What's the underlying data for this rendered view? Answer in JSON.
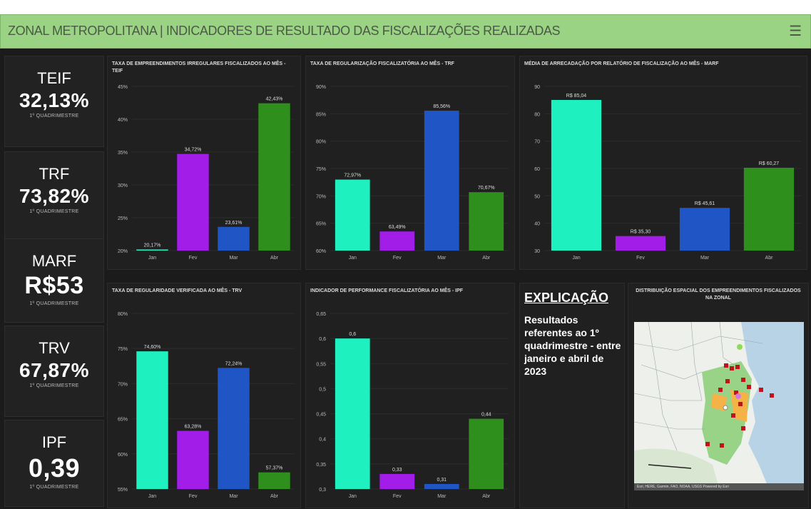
{
  "header": {
    "title": "ZONAL METROPOLITANA | INDICADORES DE RESULTADO DAS FISCALIZAÇÕES REALIZADAS",
    "menu_icon": "hamburger-menu-icon"
  },
  "kpis": [
    {
      "code": "TEIF",
      "value": "32,13%",
      "sub": "1º QUADRIMESTRE"
    },
    {
      "code": "TRF",
      "value": "73,82%",
      "sub": "1º QUADRIMESTRE"
    },
    {
      "code": "MARF",
      "value": "R$53",
      "sub": "1º QUADRIMESTRE"
    },
    {
      "code": "TRV",
      "value": "67,87%",
      "sub": "1º QUADRIMESTRE"
    },
    {
      "code": "IPF",
      "value": "0,39",
      "sub": "1º QUADRIMESTRE"
    }
  ],
  "colors": {
    "jan": "#1ff0c0",
    "fev": "#a21ee8",
    "mar": "#1f55c4",
    "abr": "#2f8f1c",
    "background": "#1b1b1b",
    "header": "#9ad383"
  },
  "chart_data": [
    {
      "type": "bar",
      "title": "TAXA DE EMPREENDIMENTOS IRREGULARES FISCALIZADOS AO MÊS - TEIF",
      "categories": [
        "Jan",
        "Fev",
        "Mar",
        "Abr"
      ],
      "values": [
        20.17,
        34.72,
        23.61,
        42.43
      ],
      "data_labels": [
        "20,17%",
        "34,72%",
        "23,61%",
        "42,43%"
      ],
      "yticks": [
        "20%",
        "25%",
        "30%",
        "35%",
        "40%",
        "45%"
      ],
      "ylim": [
        20,
        45
      ]
    },
    {
      "type": "bar",
      "title": "TAXA DE REGULARIZAÇÃO FISCALIZATÓRIA AO MÊS - TRF",
      "categories": [
        "Jan",
        "Fev",
        "Mar",
        "Abr"
      ],
      "values": [
        72.97,
        63.49,
        85.56,
        70.67
      ],
      "data_labels": [
        "72,97%",
        "63,49%",
        "85,56%",
        "70,67%"
      ],
      "yticks": [
        "60%",
        "65%",
        "70%",
        "75%",
        "80%",
        "85%",
        "90%"
      ],
      "ylim": [
        60,
        90
      ]
    },
    {
      "type": "bar",
      "title": "MÉDIA DE ARRECADAÇÃO POR RELATÓRIO DE FISCALIZAÇÃO AO MÊS - MARF",
      "categories": [
        "Jan",
        "Fev",
        "Mar",
        "Abr"
      ],
      "values": [
        85.04,
        35.3,
        45.61,
        60.27
      ],
      "data_labels": [
        "R$ 85,04",
        "R$ 35,30",
        "R$ 45,61",
        "R$ 60,27"
      ],
      "yticks": [
        "30",
        "40",
        "50",
        "60",
        "70",
        "80",
        "90"
      ],
      "ylim": [
        30,
        90
      ]
    },
    {
      "type": "bar",
      "title": "TAXA DE REGULARIDADE VERIFICADA AO MÊS - TRV",
      "categories": [
        "Jan",
        "Fev",
        "Mar",
        "Abr"
      ],
      "values": [
        74.6,
        63.28,
        72.24,
        57.37
      ],
      "data_labels": [
        "74,60%",
        "63,28%",
        "72,24%",
        "57,37%"
      ],
      "yticks": [
        "55%",
        "60%",
        "65%",
        "70%",
        "75%",
        "80%"
      ],
      "ylim": [
        55,
        80
      ]
    },
    {
      "type": "bar",
      "title": "INDICADOR DE PERFORMANCE FISCALIZATÓRIA AO MÊS - IPF",
      "categories": [
        "Jan",
        "Fev",
        "Mar",
        "Abr"
      ],
      "values": [
        0.6,
        0.33,
        0.31,
        0.44
      ],
      "data_labels": [
        "0,6",
        "0,33",
        "0,31",
        "0,44"
      ],
      "yticks": [
        "0,3",
        "0,35",
        "0,4",
        "0,45",
        "0,5",
        "0,55",
        "0,6",
        "0,65"
      ],
      "ylim": [
        0.3,
        0.65
      ]
    }
  ],
  "explanation": {
    "title": "EXPLICAÇÃO",
    "text": "Resultados referentes ao 1º quadrimestre - entre janeiro e abril de 2023"
  },
  "map": {
    "title": "DISTRIBUIÇÃO ESPACIAL DOS EMPREENDIMENTOS FISCALIZADOS NA ZONAL",
    "attribution": "Esri, HERE, Garmin, FAO, NOAA, USGS    Powered by Esri"
  }
}
